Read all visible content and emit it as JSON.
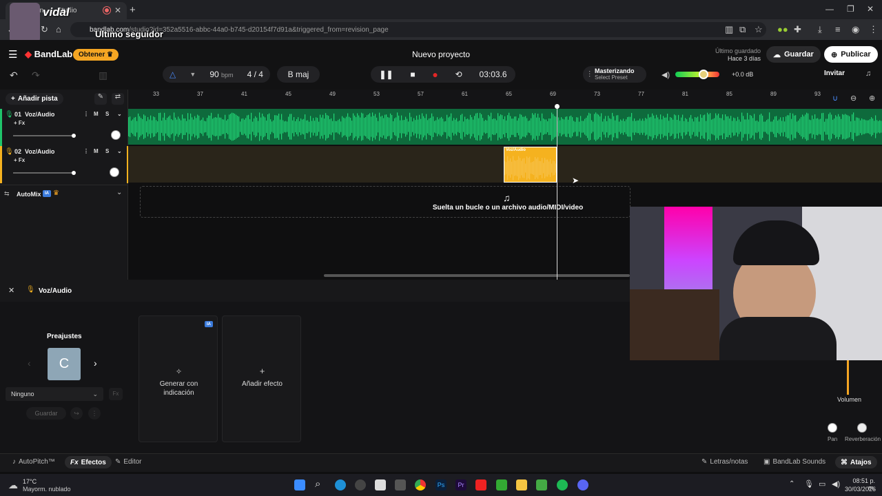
{
  "browser": {
    "tab_title": "on ... - Studio",
    "url_host": "bandlab.com",
    "url_path": "/studio?id=352a5516-abbc-44a0-b745-d20154f7d91a&triggered_from=revision_page"
  },
  "overlay": {
    "name": "vidal",
    "caption": "Ultimo seguidor"
  },
  "header": {
    "brand": "BandLab",
    "obtener": "Obtener",
    "project_title": "Nuevo proyecto",
    "last_saved_label": "Último guardado",
    "last_saved_value": "Hace 3 días",
    "save": "Guardar",
    "publish": "Publicar"
  },
  "transport": {
    "bpm": "90",
    "bpm_unit": "bpm",
    "time_sig": "4 / 4",
    "key": "B maj",
    "time": "03:03.6",
    "mastering_title": "Masterizando",
    "mastering_preset": "Select Preset",
    "db": "+0.0 dB",
    "invite": "Invitar"
  },
  "tracks_panel": {
    "add_track": "Añadir pista",
    "tracks": [
      {
        "num": "01",
        "name": "Voz/Audio",
        "fx": "+ Fx",
        "m": "M",
        "s": "S"
      },
      {
        "num": "02",
        "name": "Voz/Audio",
        "fx": "+ Fx",
        "m": "M",
        "s": "S"
      }
    ],
    "automix": "AutoMix",
    "ia": "IA"
  },
  "ruler": [
    "33",
    "37",
    "41",
    "45",
    "49",
    "53",
    "57",
    "61",
    "65",
    "69",
    "73",
    "77",
    "81",
    "85",
    "89",
    "93"
  ],
  "region_label": "Voz/Audio",
  "drop_text": "Suelta un bucle o un archivo audio/MIDI/video",
  "editor": {
    "track_name": "Voz/Audio",
    "presets_label": "Preajustes",
    "preset_letter": "C",
    "preset_select": "Ninguno",
    "preset_save": "Guardar",
    "ia_badge": "IA",
    "generate": "Generar con indicación",
    "add_effect": "Añadir efecto",
    "volume": "Volumen",
    "pan": "Pan",
    "reverb": "Reverberación"
  },
  "bottom_tabs": {
    "autopitch": "AutoPitch™",
    "effects": "Efectos",
    "editor": "Editor",
    "lyrics": "Letras/notas",
    "sounds": "BandLab Sounds",
    "shortcuts": "Atajos"
  },
  "taskbar": {
    "temp": "17°C",
    "weather": "Mayorm. nublado",
    "time": "08:51 p. m.",
    "date": "30/03/2026"
  },
  "colors": {
    "accent": "#f5a623",
    "track1": "#1fc46a",
    "track2": "#f5b21f",
    "record": "#e32626"
  }
}
